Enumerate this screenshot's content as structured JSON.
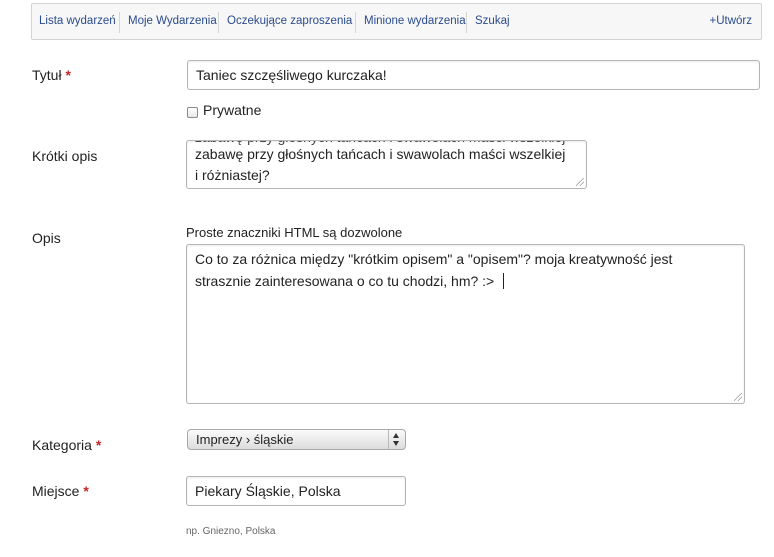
{
  "nav": {
    "items": [
      {
        "label": "Lista wydarzeń"
      },
      {
        "label": "Moje Wydarzenia"
      },
      {
        "label": "Oczekujące zaproszenia"
      },
      {
        "label": "Minione wydarzenia"
      },
      {
        "label": "Szukaj"
      }
    ],
    "create_label": "+Utwórz"
  },
  "form": {
    "title": {
      "label": "Tytuł",
      "required_mark": "*",
      "value": "Taniec szczęśliwego kurczaka!"
    },
    "private": {
      "label": "Prywatne",
      "checked": false
    },
    "short_description": {
      "label": "Krótki opis",
      "visible_lines": [
        "zabawę przy głośnych tańcach i swawolach maści wszelkiej",
        "i różniastej?"
      ]
    },
    "description": {
      "label": "Opis",
      "hint": "Proste znaczniki HTML są dozwolone",
      "lines": [
        "Co to za różnica między \"krótkim opisem\" a \"opisem\"? moja kreatywność jest",
        "strasznie zainteresowana o co tu chodzi, hm? :>"
      ]
    },
    "category": {
      "label": "Kategoria",
      "required_mark": "*",
      "selected": "Imprezy › śląskie"
    },
    "place": {
      "label": "Miejsce",
      "required_mark": "*",
      "value": "Piekary Śląskie, Polska",
      "example": "np. Gniezno, Polska"
    }
  },
  "colors": {
    "link": "#2a4b8d",
    "required": "#c0272d",
    "nav_bg": "#f7f7f7"
  }
}
